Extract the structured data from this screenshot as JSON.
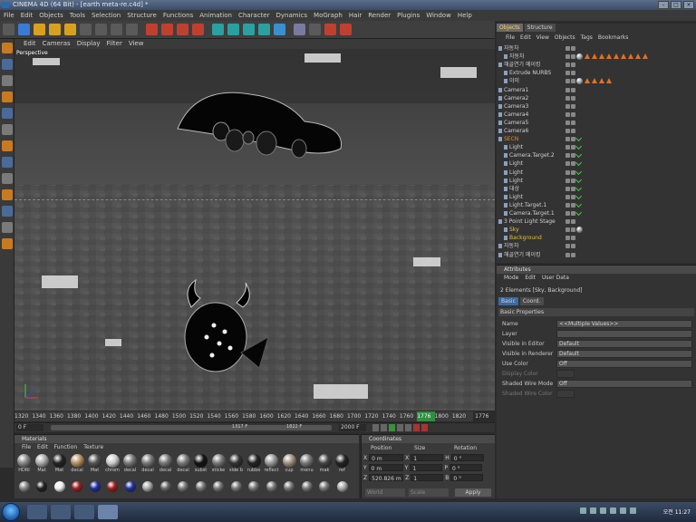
{
  "window": {
    "title": "CINEMA 4D (64 Bit) - [earth meta-re.c4d] *"
  },
  "menubar": [
    "File",
    "Edit",
    "Objects",
    "Tools",
    "Selection",
    "Structure",
    "Functions",
    "Animation",
    "Character",
    "Dynamics",
    "MoGraph",
    "Hair",
    "Render",
    "Plugins",
    "Window",
    "Help"
  ],
  "viewport": {
    "menu": [
      "Edit",
      "Cameras",
      "Display",
      "Filter",
      "View"
    ],
    "label": "Perspective"
  },
  "timeline": {
    "ruler": [
      "1320",
      "1340",
      "1360",
      "1380",
      "1400",
      "1420",
      "1440",
      "1460",
      "1480",
      "1500",
      "1520",
      "1540",
      "1560",
      "1580",
      "1600",
      "1620",
      "1640",
      "1660",
      "1680",
      "1700",
      "1720",
      "1740",
      "1760",
      "1776",
      "1800",
      "1820"
    ],
    "current_frame": "1776",
    "frame_box": "1776 F",
    "start": "0 F",
    "mid_a": "1317 F",
    "mid_b": "1822 F",
    "end": "2000 F"
  },
  "materials": {
    "title": "Materials",
    "menu": [
      "File",
      "Edit",
      "Function",
      "Texture"
    ],
    "row1": [
      "HDRI",
      "Mat",
      "Mat",
      "decal",
      "Mat",
      "chrom",
      "decal",
      "decal",
      "decal",
      "decal",
      "subst",
      "sticke",
      "side b",
      "rubbe",
      "reflect",
      "cup",
      "menu",
      "mak",
      "ref"
    ],
    "row2_count": 19
  },
  "coordinates": {
    "title": "Coordinates",
    "headers": [
      "Position",
      "Size",
      "Rotation"
    ],
    "rows": [
      {
        "axis": "X",
        "pos": "0 m",
        "size_axis": "X",
        "size": "1",
        "rot_axis": "H",
        "rot": "0 °"
      },
      {
        "axis": "Y",
        "pos": "0 m",
        "size_axis": "Y",
        "size": "1",
        "rot_axis": "P",
        "rot": "0 °"
      },
      {
        "axis": "Z",
        "pos": "520.826 m",
        "size_axis": "Z",
        "size": "1",
        "rot_axis": "B",
        "rot": "0 °"
      }
    ],
    "mode_a": "World",
    "mode_b": "Scale",
    "apply": "Apply"
  },
  "objects_panel": {
    "tabs": [
      "Objects",
      "Structure"
    ],
    "menu": [
      "File",
      "Edit",
      "View",
      "Objects",
      "Tags",
      "Bookmarks"
    ],
    "items": [
      {
        "name": "자동차",
        "color": "#d0d0d0",
        "indent": 0
      },
      {
        "name": "자동차",
        "color": "#d0d0d0",
        "indent": 1
      },
      {
        "name": "해골연기 메이킹",
        "color": "#d0d0d0",
        "indent": 0
      },
      {
        "name": "Extrude NURBS",
        "color": "#d0d0d0",
        "indent": 1
      },
      {
        "name": "이미",
        "color": "#d0d0d0",
        "indent": 1
      },
      {
        "name": "Camera1",
        "color": "#d0d0d0",
        "indent": 0
      },
      {
        "name": "Camera2",
        "color": "#d0d0d0",
        "indent": 0
      },
      {
        "name": "Camera3",
        "color": "#d0d0d0",
        "indent": 0
      },
      {
        "name": "Camera4",
        "color": "#d0d0d0",
        "indent": 0
      },
      {
        "name": "Camera5",
        "color": "#d0d0d0",
        "indent": 0
      },
      {
        "name": "Camera6",
        "color": "#d0d0d0",
        "indent": 0
      },
      {
        "name": "SECN",
        "color": "#e08a30",
        "indent": 0
      },
      {
        "name": "Light",
        "color": "#d0d0d0",
        "indent": 1
      },
      {
        "name": "Camera.Target.2",
        "color": "#d0d0d0",
        "indent": 1
      },
      {
        "name": "Light",
        "color": "#d0d0d0",
        "indent": 1
      },
      {
        "name": "Light",
        "color": "#d0d0d0",
        "indent": 1
      },
      {
        "name": "Light",
        "color": "#d0d0d0",
        "indent": 1
      },
      {
        "name": "대상",
        "color": "#d0d0d0",
        "indent": 1
      },
      {
        "name": "Light",
        "color": "#d0d0d0",
        "indent": 1
      },
      {
        "name": "Light.Target.1",
        "color": "#d0d0d0",
        "indent": 1
      },
      {
        "name": "Camera.Target.1",
        "color": "#d0d0d0",
        "indent": 1
      },
      {
        "name": "3 Point Light Stage",
        "color": "#d0d0d0",
        "indent": 0
      },
      {
        "name": "Sky",
        "color": "#e8c030",
        "indent": 1
      },
      {
        "name": "Background",
        "color": "#e8c030",
        "indent": 1
      },
      {
        "name": "자동차",
        "color": "#d0d0d0",
        "indent": 0
      },
      {
        "name": "해골연기 메이킹",
        "color": "#d0d0d0",
        "indent": 0
      }
    ]
  },
  "attributes": {
    "title": "Attributes",
    "menu": [
      "Mode",
      "Edit",
      "User Data"
    ],
    "summary": "2 Elements [Sky, Background]",
    "tabs": [
      "Basic",
      "Coord."
    ],
    "section": "Basic Properties",
    "rows": [
      {
        "label": "Name",
        "value": "<<Multiple Values>>",
        "dim": false
      },
      {
        "label": "Layer",
        "value": "",
        "dim": false
      },
      {
        "label": "Visible in Editor",
        "value": "Default",
        "dim": false
      },
      {
        "label": "Visible in Renderer",
        "value": "Default",
        "dim": false
      },
      {
        "label": "Use Color",
        "value": "Off",
        "dim": false
      },
      {
        "label": "Display Color",
        "value": "",
        "dim": true
      },
      {
        "label": "Shaded Wire Mode",
        "value": "Off",
        "dim": false
      },
      {
        "label": "Shaded Wire Color",
        "value": "",
        "dim": true
      }
    ]
  },
  "taskbar": {
    "clock": "오전 11:27"
  }
}
